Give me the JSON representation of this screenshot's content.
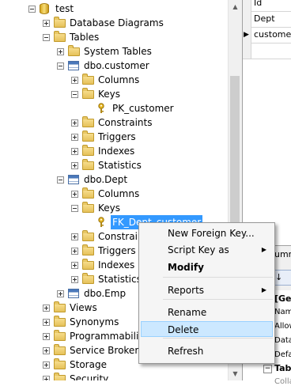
{
  "tree": {
    "items": [
      {
        "label": "test",
        "icon": "database-icon",
        "expander": "minus"
      },
      {
        "label": "Database Diagrams",
        "icon": "folder-icon",
        "expander": "plus"
      },
      {
        "label": "Tables",
        "icon": "folder-icon",
        "expander": "minus"
      },
      {
        "label": "System Tables",
        "icon": "folder-icon",
        "expander": "plus"
      },
      {
        "label": "dbo.customer",
        "icon": "table-icon",
        "expander": "minus"
      },
      {
        "label": "Columns",
        "icon": "folder-icon",
        "expander": "plus"
      },
      {
        "label": "Keys",
        "icon": "folder-icon",
        "expander": "minus"
      },
      {
        "label": "PK_customer",
        "icon": "key-icon",
        "expander": "none"
      },
      {
        "label": "Constraints",
        "icon": "folder-icon",
        "expander": "plus"
      },
      {
        "label": "Triggers",
        "icon": "folder-icon",
        "expander": "plus"
      },
      {
        "label": "Indexes",
        "icon": "folder-icon",
        "expander": "plus"
      },
      {
        "label": "Statistics",
        "icon": "folder-icon",
        "expander": "plus"
      },
      {
        "label": "dbo.Dept",
        "icon": "table-icon",
        "expander": "minus"
      },
      {
        "label": "Columns",
        "icon": "folder-icon",
        "expander": "plus"
      },
      {
        "label": "Keys",
        "icon": "folder-icon",
        "expander": "minus"
      },
      {
        "label": "FK_Dept_customer",
        "icon": "key-icon",
        "expander": "none",
        "selected": true
      },
      {
        "label": "Constraints",
        "icon": "folder-icon",
        "expander": "plus"
      },
      {
        "label": "Triggers",
        "icon": "folder-icon",
        "expander": "plus"
      },
      {
        "label": "Indexes",
        "icon": "folder-icon",
        "expander": "plus"
      },
      {
        "label": "Statistics",
        "icon": "folder-icon",
        "expander": "plus"
      },
      {
        "label": "dbo.Emp",
        "icon": "table-icon",
        "expander": "plus"
      },
      {
        "label": "Views",
        "icon": "folder-icon",
        "expander": "plus"
      },
      {
        "label": "Synonyms",
        "icon": "folder-icon",
        "expander": "plus"
      },
      {
        "label": "Programmability",
        "icon": "folder-icon",
        "expander": "plus"
      },
      {
        "label": "Service Broker",
        "icon": "folder-icon",
        "expander": "plus"
      },
      {
        "label": "Storage",
        "icon": "folder-icon",
        "expander": "plus"
      },
      {
        "label": "Security",
        "icon": "folder-icon",
        "expander": "plus"
      }
    ]
  },
  "grid": {
    "rows": [
      "Id",
      "Dept",
      "customer"
    ]
  },
  "properties": {
    "header_partial": "umn",
    "rows": [
      "[Gen",
      "Nam",
      "Allow",
      "Data",
      "Defa"
    ],
    "section": "Tabl",
    "last": "Colla"
  },
  "context_menu": {
    "items": [
      {
        "label": "New Foreign Key...",
        "bold": false,
        "submenu": false
      },
      {
        "label": "Script Key as",
        "bold": false,
        "submenu": true
      },
      {
        "label": "Modify",
        "bold": true,
        "submenu": false
      },
      {
        "label": "Reports",
        "bold": false,
        "submenu": true
      },
      {
        "label": "Rename",
        "bold": false,
        "submenu": false
      },
      {
        "label": "Delete",
        "bold": false,
        "submenu": false,
        "highlighted": true
      },
      {
        "label": "Refresh",
        "bold": false,
        "submenu": false
      }
    ]
  },
  "colors": {
    "selection": "#3399ff",
    "menu_highlight": "#cce8ff"
  }
}
